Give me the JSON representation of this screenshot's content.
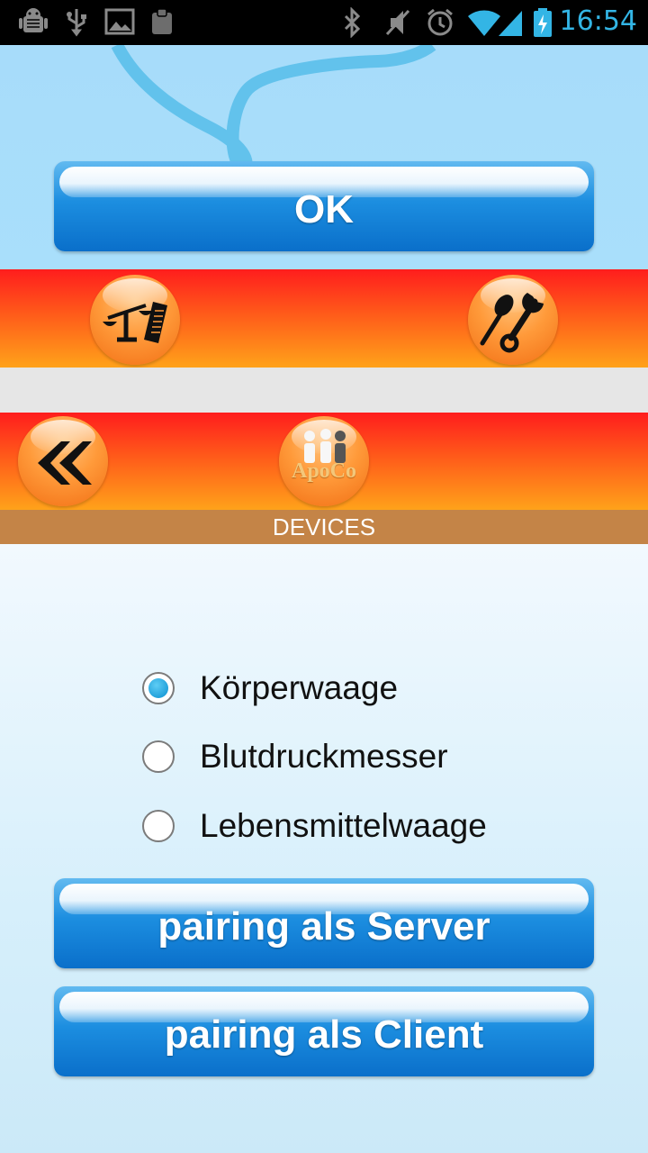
{
  "status_bar": {
    "time": "16:54",
    "left_icons": [
      "android-debug-icon",
      "usb-icon",
      "image-icon",
      "clipboard-icon"
    ],
    "right_icons": [
      "bluetooth-icon",
      "mute-icon",
      "alarm-icon",
      "wifi-icon",
      "signal-icon",
      "battery-charging-icon"
    ],
    "time_color": "#33b5e5"
  },
  "top": {
    "ok_label": "OK"
  },
  "toolbar_1": {
    "left_icon": "scale-icon",
    "right_icon": "tools-icon"
  },
  "toolbar_2": {
    "left_icon": "double-chevron-left-icon",
    "center_logo_text": "ApoCo"
  },
  "section": {
    "title": "DEVICES"
  },
  "devices": {
    "options": [
      {
        "label": "Körperwaage",
        "checked": true
      },
      {
        "label": "Blutdruckmesser",
        "checked": false
      },
      {
        "label": "Lebensmittelwaage",
        "checked": false
      }
    ]
  },
  "actions": {
    "server_label": "pairing als Server",
    "client_label": "pairing als Client"
  },
  "colors": {
    "accent_blue": "#0a6fca",
    "bar_top": "#ff1d1d",
    "bar_bottom": "#ffa21a",
    "header_brown": "#c48447"
  }
}
